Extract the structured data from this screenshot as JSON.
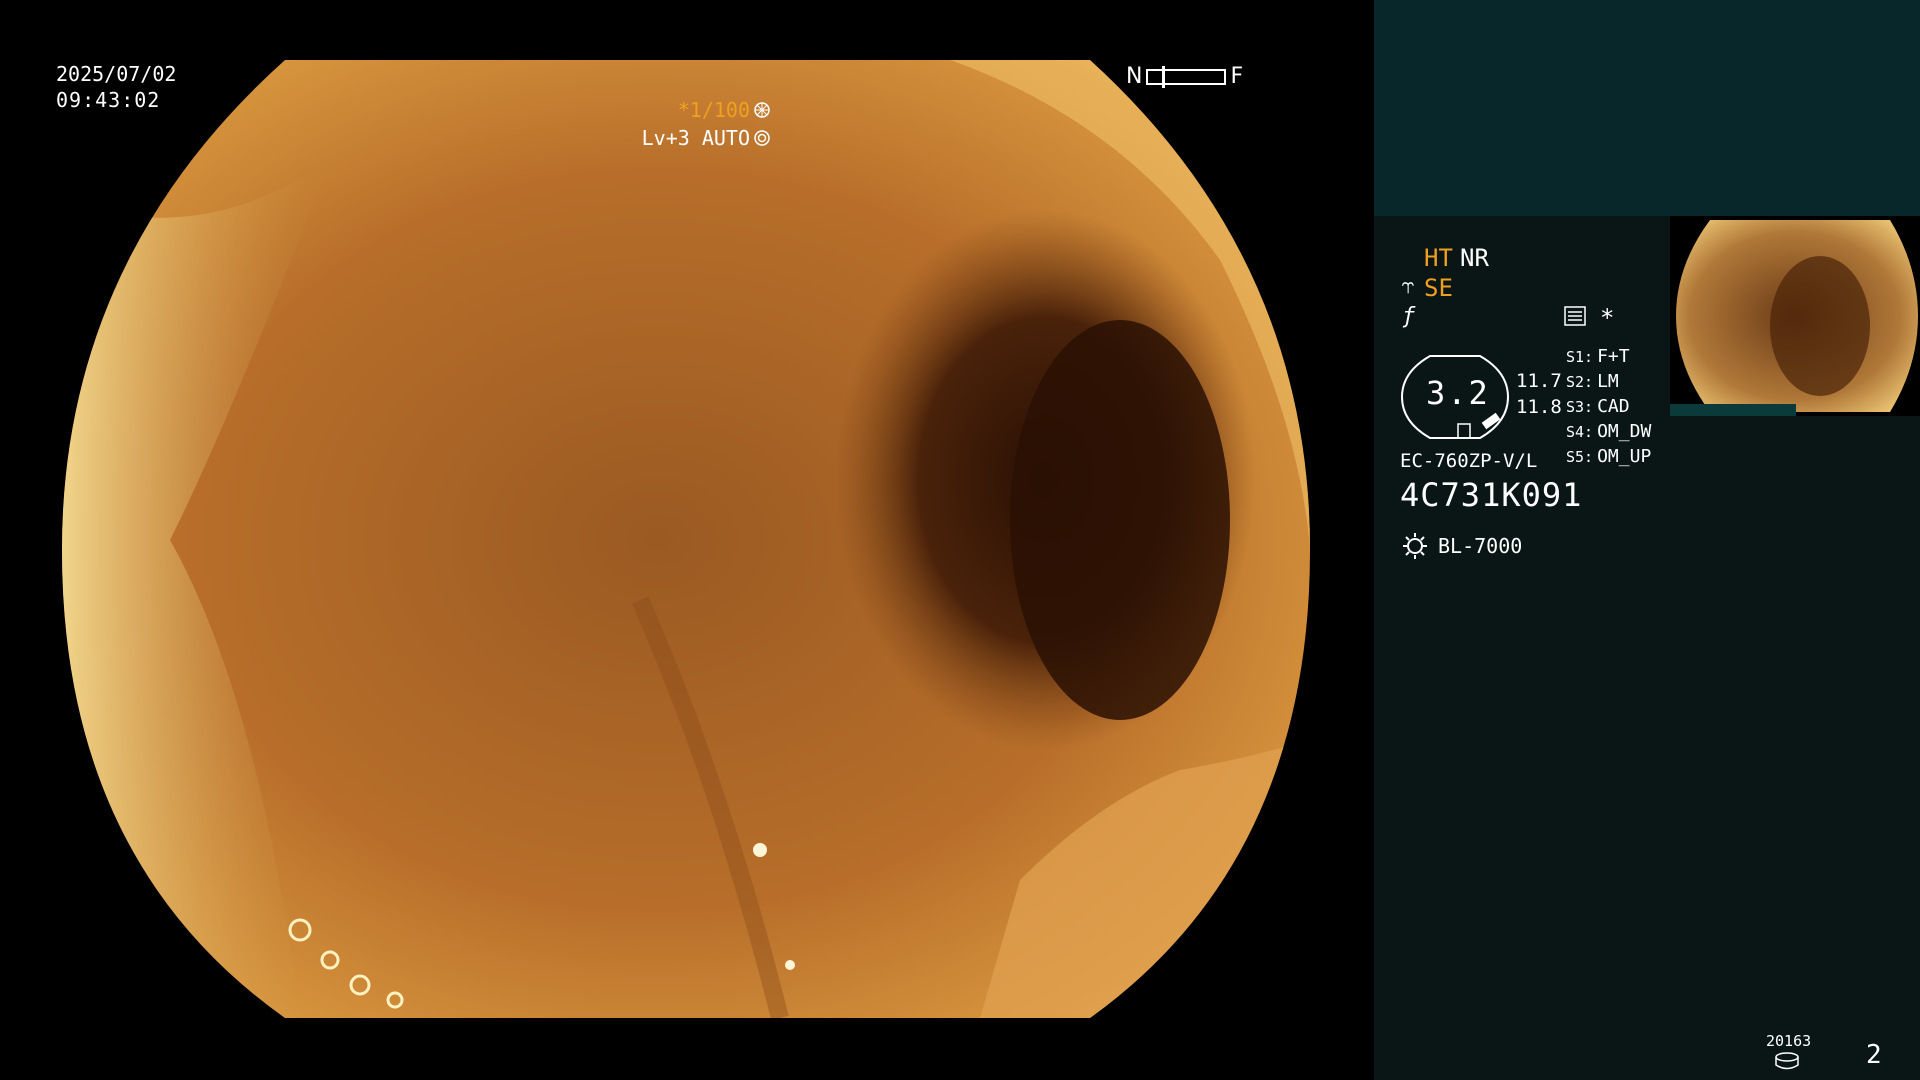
{
  "overlay": {
    "date": "2025/07/02",
    "time": "09:43:02",
    "near_label": "N",
    "far_label": "F",
    "shutter": "*1/100",
    "level": "Lv+3 AUTO"
  },
  "side_panel": {
    "ht": "HT",
    "nr": "NR",
    "se": "SE",
    "star": "*",
    "dial_value": "3.2",
    "value_1": "11.7",
    "value_2": "11.8",
    "switches": [
      {
        "key": "S1:",
        "label": "F+T"
      },
      {
        "key": "S2:",
        "label": "LM"
      },
      {
        "key": "S3:",
        "label": "CAD"
      },
      {
        "key": "S4:",
        "label": "OM_DW"
      },
      {
        "key": "S5:",
        "label": "OM_UP"
      }
    ],
    "scope_model": "EC-760ZP-V/L",
    "scope_serial": "4C731K091",
    "light_source": "BL-7000",
    "image_count": "20163",
    "page_number": "2"
  },
  "colors": {
    "accent": "#f0a020",
    "side_top": "#07272a",
    "side_bg": "#0a1616",
    "tissue": "#c07a30"
  },
  "icons": [
    "se-icon",
    "f-icon",
    "settings-menu-icon",
    "sun-icon",
    "disk-icon",
    "shutter-icon",
    "auto-icon"
  ]
}
